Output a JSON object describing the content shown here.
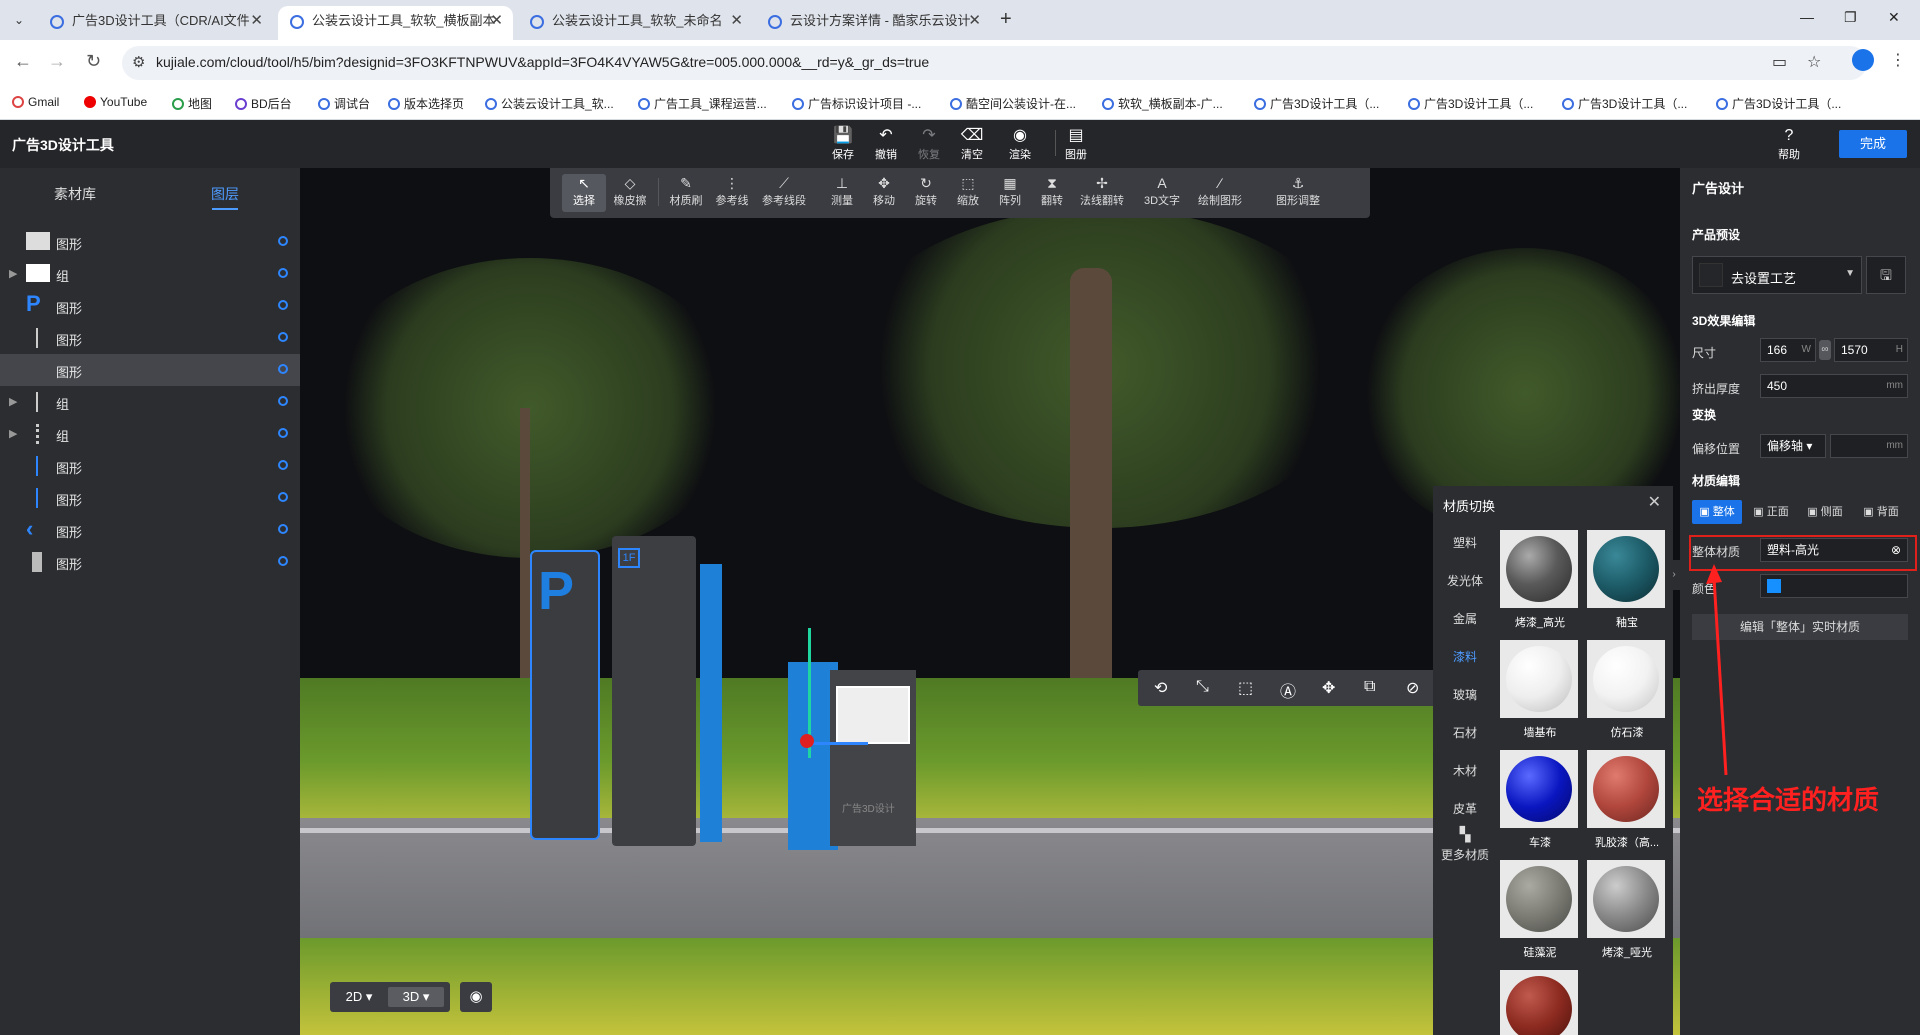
{
  "browser": {
    "tabs": [
      {
        "title": "广告3D设计工具（CDR/AI文件",
        "active": false
      },
      {
        "title": "公装云设计工具_软软_横板副本",
        "active": true
      },
      {
        "title": "公装云设计工具_软软_未命名",
        "active": false
      },
      {
        "title": "云设计方案详情 - 酷家乐云设计",
        "active": false
      }
    ],
    "url": "kujiale.com/cloud/tool/h5/bim?designid=3FO3KFTNPWUV&appId=3FO4K4VYAW5G&tre=005.000.000&__rd=y&_gr_ds=true",
    "bookmarks": [
      "Gmail",
      "YouTube",
      "地图",
      "BD后台",
      "调试台",
      "版本选择页",
      "公装云设计工具_软...",
      "广告工具_课程运营...",
      "广告标识设计项目 -...",
      "酷空间公装设计-在...",
      "软软_横板副本-广...",
      "广告3D设计工具（...",
      "广告3D设计工具（...",
      "广告3D设计工具（...",
      "广告3D设计工具（..."
    ]
  },
  "app": {
    "title": "广告3D设计工具",
    "header_buttons": {
      "save": "保存",
      "undo": "撤销",
      "redo": "恢复",
      "clear": "清空",
      "render": "渲染",
      "drawing": "图册",
      "help": "帮助",
      "done": "完成"
    },
    "left_tabs": {
      "materials": "素材库",
      "layers": "图层"
    },
    "layers": [
      {
        "name": "图形",
        "arrow": false
      },
      {
        "name": "组",
        "arrow": true
      },
      {
        "name": "图形",
        "arrow": false
      },
      {
        "name": "图形",
        "arrow": false
      },
      {
        "name": "图形",
        "arrow": false,
        "selected": true
      },
      {
        "name": "组",
        "arrow": true
      },
      {
        "name": "组",
        "arrow": true
      },
      {
        "name": "图形",
        "arrow": false
      },
      {
        "name": "图形",
        "arrow": false
      },
      {
        "name": "图形",
        "arrow": false
      },
      {
        "name": "图形",
        "arrow": false
      }
    ],
    "toolbar": [
      "选择",
      "橡皮擦",
      "材质刷",
      "参考线",
      "参考线段",
      "测量",
      "移动",
      "旋转",
      "缩放",
      "阵列",
      "翻转",
      "法线翻转",
      "3D文字",
      "绘制图形",
      "图形调整"
    ],
    "view": {
      "mode2d": "2D",
      "mode3d": "3D"
    },
    "scene_text": {
      "sign_floor": "1F",
      "sign_caption": "广告3D设计"
    },
    "material_panel": {
      "title": "材质切换",
      "categories": [
        "塑料",
        "发光体",
        "金属",
        "漆料",
        "玻璃",
        "石材",
        "木材",
        "皮革",
        "更多材质"
      ],
      "active_category": "漆料",
      "items": [
        {
          "name": "烤漆_高光",
          "color": "#5a5a5a"
        },
        {
          "name": "釉宝",
          "color": "#1c5a66"
        },
        {
          "name": "墙基布",
          "color": "#f2f2f2"
        },
        {
          "name": "仿石漆",
          "color": "#f5f5f5"
        },
        {
          "name": "车漆",
          "color": "#0a16c0"
        },
        {
          "name": "乳胶漆（高...",
          "color": "#b0463c"
        },
        {
          "name": "硅藻泥",
          "color": "#7b7b74"
        },
        {
          "name": "烤漆_哑光",
          "color": "#888888"
        },
        {
          "name": "",
          "color": "#8c2a20"
        }
      ]
    },
    "right_panel": {
      "header": "广告设计",
      "preset_section": "产品预设",
      "preset_value": "去设置工艺",
      "effect_section": "3D效果编辑",
      "size_label": "尺寸",
      "width": "166",
      "width_unit": "W",
      "height": "1570",
      "height_unit": "H",
      "extrude_label": "挤出厚度",
      "extrude": "450",
      "mm": "mm",
      "transform_section": "变换",
      "offset_label": "偏移位置",
      "offset_axis": "偏移轴",
      "material_section": "材质编辑",
      "faces": [
        "整体",
        "正面",
        "侧面",
        "背面"
      ],
      "whole_material_label": "整体材质",
      "whole_material_value": "塑料-高光",
      "color_label": "颜色",
      "color_value": "#1790ff",
      "edit_button": "编辑「整体」实时材质"
    },
    "annotation": "选择合适的材质"
  }
}
